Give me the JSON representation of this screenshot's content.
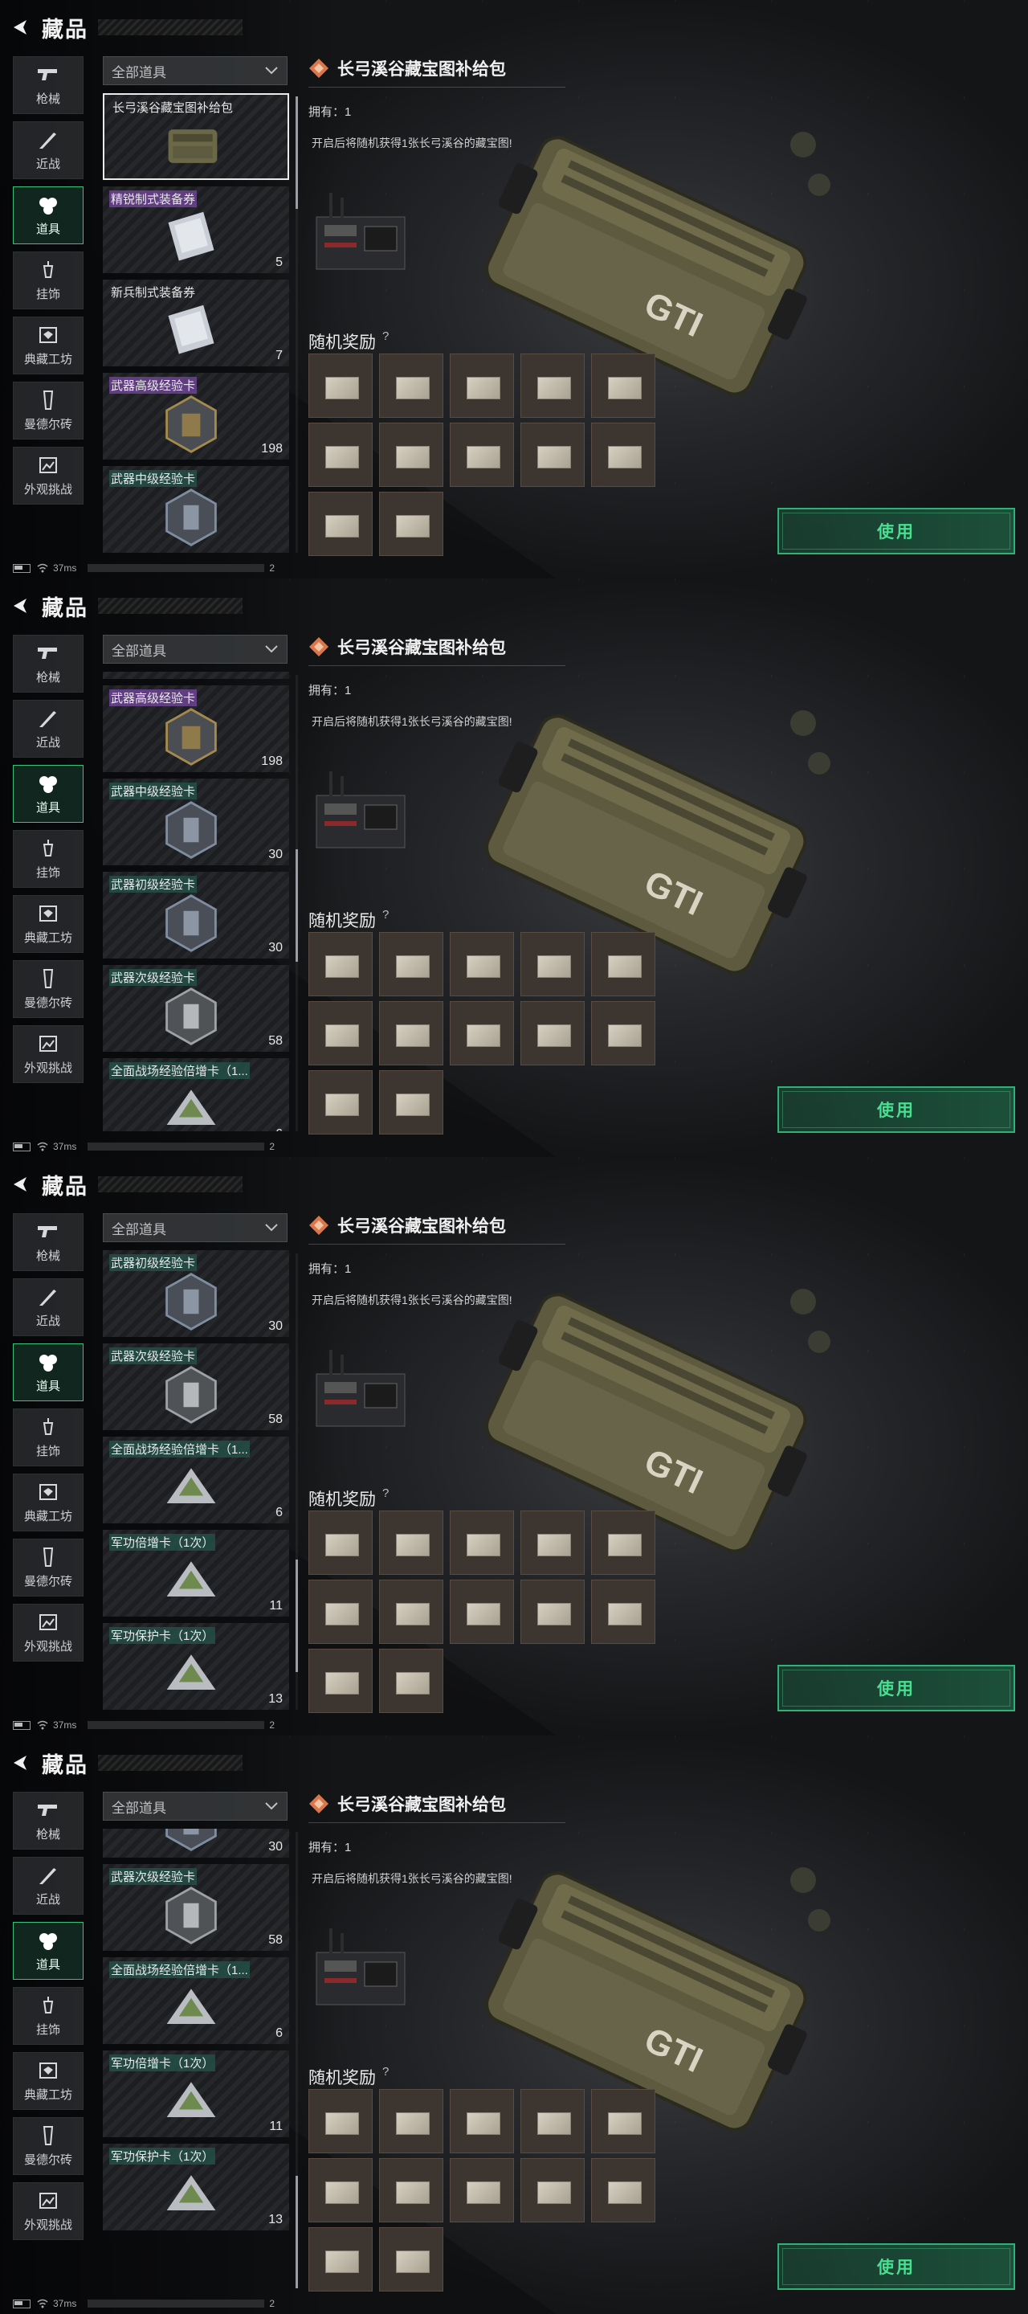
{
  "header": {
    "title": "藏品"
  },
  "nav": [
    {
      "label": "枪械",
      "icon": "gun-icon"
    },
    {
      "label": "近战",
      "icon": "knife-icon"
    },
    {
      "label": "道具",
      "icon": "items-icon",
      "active": true
    },
    {
      "label": "挂饰",
      "icon": "charm-icon"
    },
    {
      "label": "典藏工坊",
      "icon": "workshop-icon"
    },
    {
      "label": "曼德尔砖",
      "icon": "brick-icon"
    },
    {
      "label": "外观挑战",
      "icon": "challenge-icon"
    }
  ],
  "filter": {
    "label": "全部道具"
  },
  "items": [
    {
      "name": "长弓溪谷藏宝图补给包",
      "qty": "",
      "tag": "plain",
      "art": "crate"
    },
    {
      "name": "精锐制式装备券",
      "qty": "5",
      "tag": "purple",
      "art": "ticket"
    },
    {
      "name": "新兵制式装备券",
      "qty": "7",
      "tag": "plain",
      "art": "ticket"
    },
    {
      "name": "武器高级经验卡",
      "qty": "198",
      "tag": "purple",
      "art": "hex-gold"
    },
    {
      "name": "武器中级经验卡",
      "qty": "",
      "tag": "green",
      "art": "hex-blue"
    },
    {
      "name": "武器初级经验卡",
      "qty": "30",
      "tag": "green",
      "art": "hex-blue"
    },
    {
      "name": "武器次级经验卡",
      "qty": "58",
      "tag": "green",
      "art": "hex-gray"
    },
    {
      "name": "全面战场经验倍增卡（1...",
      "qty": "6",
      "tag": "green",
      "art": "card"
    },
    {
      "name": "军功倍增卡（1次）",
      "qty": "11",
      "tag": "green",
      "art": "card"
    },
    {
      "name": "军功保护卡（1次）",
      "qty": "13",
      "tag": "green",
      "art": "card"
    }
  ],
  "views": [
    {
      "scroll_index": 0,
      "qty_override": {}
    },
    {
      "scroll_index": 2.85,
      "qty_override": {
        "4": "30"
      }
    },
    {
      "scroll_index": 5,
      "qty_override": {}
    },
    {
      "scroll_index": 5.62,
      "qty_override": {}
    }
  ],
  "detail": {
    "title": "长弓溪谷藏宝图补给包",
    "owned": "拥有：1",
    "description": "开启后将随机获得1张长弓溪谷的藏宝图!",
    "reward_title": "随机奖励",
    "reward_help": "?",
    "reward_count": 12,
    "use_label": "使用"
  },
  "status": {
    "ping": "37ms",
    "page": "2"
  },
  "colors": {
    "accent": "#39c07a",
    "purple_tag": "#7648a0",
    "green_tag": "#23554b"
  }
}
